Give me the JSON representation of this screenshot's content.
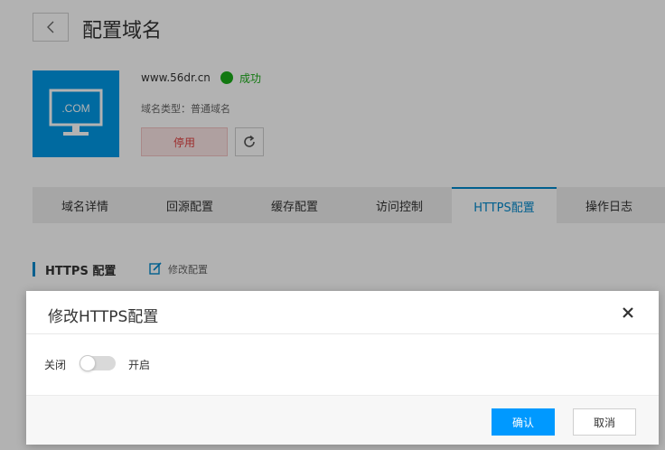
{
  "header": {
    "title": "配置域名",
    "back_icon": "chevron-left-icon"
  },
  "domain": {
    "name": "www.56dr.cn",
    "status": "成功",
    "status_color": "#1aad19",
    "type": "域名类型：普通域名",
    "icon_label": ".COM",
    "icon_bg": "#0099e5",
    "disable_label": "停用"
  },
  "tabs": [
    {
      "label": "域名详情"
    },
    {
      "label": "回源配置"
    },
    {
      "label": "缓存配置"
    },
    {
      "label": "访问控制"
    },
    {
      "label": "HTTPS配置"
    },
    {
      "label": "操作日志"
    }
  ],
  "active_tab": "HTTPS配置",
  "section": {
    "title": "HTTPS 配置",
    "edit_label": "修改配置"
  },
  "modal": {
    "title": "修改HTTPS配置",
    "switch_off_label": "关闭",
    "switch_on_label": "开启",
    "switch_state": "off",
    "confirm_label": "确认",
    "cancel_label": "取消"
  },
  "colors": {
    "accent": "#0099ff",
    "danger": "#e04040"
  }
}
